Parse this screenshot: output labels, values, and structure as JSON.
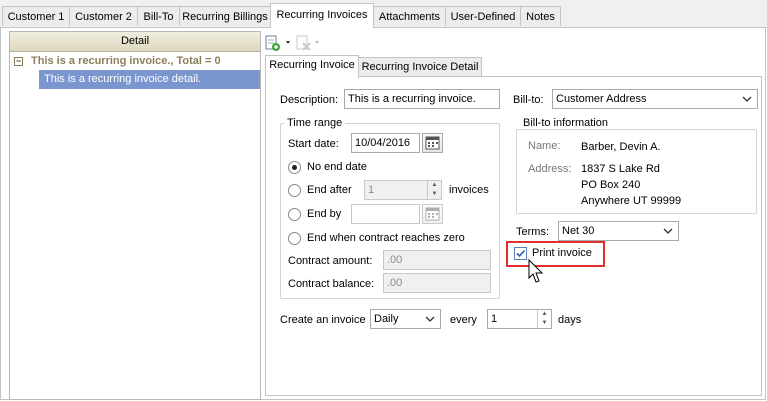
{
  "tabs": [
    "Customer 1",
    "Customer 2",
    "Bill-To",
    "Recurring Billings",
    "Recurring Invoices",
    "Attachments",
    "User-Defined",
    "Notes"
  ],
  "active_tab": "Recurring Invoices",
  "left_panel": {
    "header": "Detail",
    "group_label": "This is a recurring invoice., Total = 0",
    "row_label": "This is a recurring invoice detail."
  },
  "toolbar": {
    "add_icon": "add-document-icon",
    "delete_icon": "delete-document-icon"
  },
  "subtabs": [
    "Recurring Invoice",
    "Recurring Invoice Detail"
  ],
  "form": {
    "description_label": "Description:",
    "description_value": "This is a recurring invoice.",
    "billto_label": "Bill-to:",
    "billto_value": "Customer Address",
    "time_range": {
      "title": "Time range",
      "start_date_label": "Start date:",
      "start_date_value": "10/04/2016",
      "no_end_label": "No end date",
      "end_after_label": "End after",
      "end_after_value": "1",
      "invoices_label": "invoices",
      "end_by_label": "End by",
      "end_contract_label": "End when contract reaches zero",
      "contract_amount_label": "Contract amount:",
      "contract_amount_value": ".00",
      "contract_balance_label": "Contract balance:",
      "contract_balance_value": ".00",
      "selected_option": "No end date"
    },
    "billto_info": {
      "title": "Bill-to information",
      "name_label": "Name:",
      "name_value": "Barber, Devin A.",
      "address_label": "Address:",
      "address_lines": [
        "1837 S Lake Rd",
        "PO Box 240",
        "Anywhere UT 99999"
      ]
    },
    "terms_label": "Terms:",
    "terms_value": "Net 30",
    "print_invoice_label": "Print invoice",
    "print_invoice_checked": true,
    "create_label": "Create an invoice",
    "frequency_value": "Daily",
    "every_label": "every",
    "every_value": "1",
    "days_label": "days"
  }
}
